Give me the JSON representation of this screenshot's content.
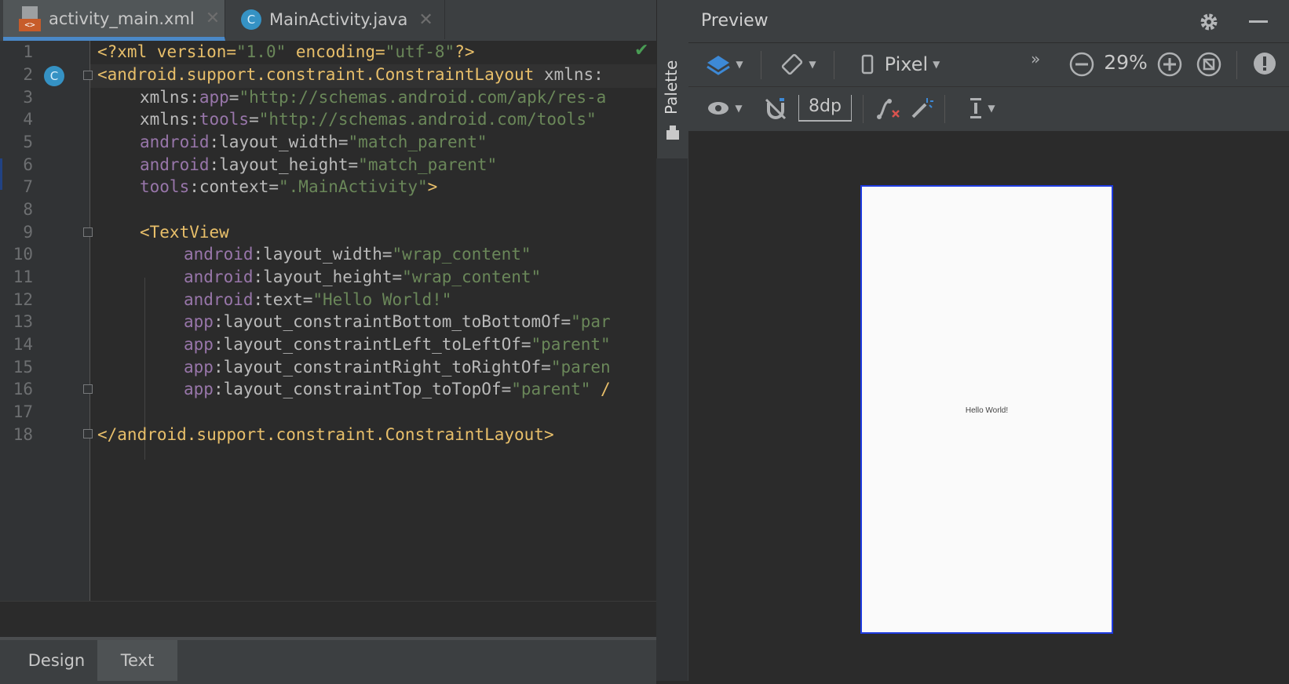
{
  "tabs": [
    {
      "label": "activity_main.xml",
      "active": true,
      "icon": "xml-file-icon"
    },
    {
      "label": "MainActivity.java",
      "active": false,
      "icon": "java-class-icon"
    }
  ],
  "gutter_class_badge": "C",
  "line_numbers": [
    "1",
    "2",
    "3",
    "4",
    "5",
    "6",
    "7",
    "8",
    "9",
    "10",
    "11",
    "12",
    "13",
    "14",
    "15",
    "16",
    "17",
    "18"
  ],
  "code": {
    "l1": {
      "a": "<?xml version=",
      "b": "\"1.0\"",
      "c": " encoding=",
      "d": "\"utf-8\"",
      "e": "?>"
    },
    "l2": {
      "a": "<android.support.constraint.ConstraintLayout",
      "b": " xmlns:"
    },
    "l3": {
      "a": "xmlns:",
      "b": "app",
      "c": "=",
      "d": "\"http://schemas.android.com/apk/res-a"
    },
    "l4": {
      "a": "xmlns:",
      "b": "tools",
      "c": "=",
      "d": "\"http://schemas.android.com/tools\""
    },
    "l5": {
      "a": "android",
      "b": ":layout_width=",
      "c": "\"match_parent\""
    },
    "l6": {
      "a": "android",
      "b": ":layout_height=",
      "c": "\"match_parent\""
    },
    "l7": {
      "a": "tools",
      "b": ":context=",
      "c": "\".MainActivity\"",
      "d": ">"
    },
    "l9": {
      "a": "<TextView"
    },
    "l10": {
      "a": "android",
      "b": ":layout_width=",
      "c": "\"wrap_content\""
    },
    "l11": {
      "a": "android",
      "b": ":layout_height=",
      "c": "\"wrap_content\""
    },
    "l12": {
      "a": "android",
      "b": ":text=",
      "c": "\"Hello World!\""
    },
    "l13": {
      "a": "app",
      "b": ":layout_constraintBottom_toBottomOf=",
      "c": "\"par"
    },
    "l14": {
      "a": "app",
      "b": ":layout_constraintLeft_toLeftOf=",
      "c": "\"parent\""
    },
    "l15": {
      "a": "app",
      "b": ":layout_constraintRight_toRightOf=",
      "c": "\"paren"
    },
    "l16": {
      "a": "app",
      "b": ":layout_constraintTop_toTopOf=",
      "c": "\"parent\"",
      "d": " /"
    },
    "l18": {
      "a": "</android.support.constraint.ConstraintLayout>"
    }
  },
  "bottom_tabs": {
    "design": "Design",
    "text": "Text"
  },
  "palette_label": "Palette",
  "preview": {
    "title": "Preview",
    "device": "Pixel",
    "zoom": "29%",
    "margin": "8dp",
    "more": "»",
    "phone_text": "Hello World!"
  },
  "colors": {
    "accent_tab": "#4a88c7",
    "phone_border": "#1e3be0",
    "tag": "#e8bf6a",
    "namespace": "#9876aa",
    "string": "#6a8759"
  }
}
